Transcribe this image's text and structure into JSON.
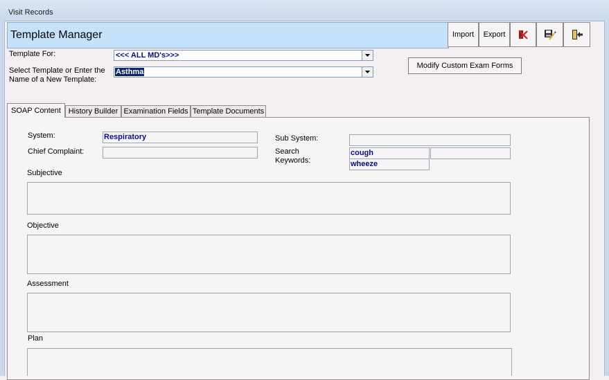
{
  "window": {
    "title": "Visit Records"
  },
  "header": {
    "title": "Template Manager"
  },
  "toolbar": {
    "import_label": "Import",
    "export_label": "Export",
    "icons": [
      "cancel-icon",
      "save-edit-icon",
      "exit-icon"
    ]
  },
  "template_for": {
    "label": "Template For:",
    "value": "<<< ALL MD's>>>"
  },
  "select_template": {
    "label_line1": "Select Template or Enter the",
    "label_line2": "Name of a New Template:",
    "value": "Asthma"
  },
  "modify_button_label": "Modify Custom Exam Forms",
  "tabs": [
    {
      "label": "SOAP Content",
      "active": true
    },
    {
      "label": "History Builder",
      "active": false
    },
    {
      "label": "Examination Fields",
      "active": false
    },
    {
      "label": "Template Documents",
      "active": false
    }
  ],
  "soap": {
    "system": {
      "label": "System:",
      "value": "Respiratory"
    },
    "sub_system": {
      "label": "Sub System:",
      "value": ""
    },
    "chief_complaint": {
      "label": "Chief Complaint:",
      "value": ""
    },
    "search_keywords": {
      "label_line1": "Search",
      "label_line2": "Keywords:",
      "values": [
        "cough",
        "wheeze",
        ""
      ]
    },
    "subjective_label": "Subjective",
    "objective_label": "Objective",
    "assessment_label": "Assessment",
    "plan_label": "Plan"
  },
  "colors": {
    "header_bg": "#c5e2fa",
    "value_text": "#0a0a8c",
    "selection": "#0a246a"
  }
}
